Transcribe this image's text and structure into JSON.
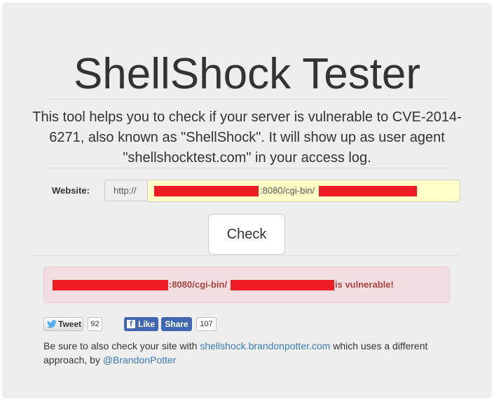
{
  "header": {
    "title": "ShellShock Tester",
    "description": "This tool helps you to check if your server is vulnerable to CVE-2014-6271, also known as \"ShellShock\". It will show up as user agent \"shellshocktest.com\" in your access log."
  },
  "form": {
    "website_label": "Website:",
    "url_prefix": "http://",
    "url_visible_part": ":8080/cgi-bin/",
    "check_button": "Check"
  },
  "result": {
    "url_visible_part": ":8080/cgi-bin/",
    "status_text": "is vulnerable!"
  },
  "social": {
    "tweet_label": "Tweet",
    "tweet_count": "92",
    "like_label": "Like",
    "share_label": "Share",
    "share_count": "107"
  },
  "footer": {
    "text_1": "Be sure to also check your site with ",
    "link_1": "shellshock.brandonpotter.com",
    "text_2": " which uses a different approach, by ",
    "link_2": "@BrandonPotter"
  },
  "colors": {
    "panel_bg": "#eeeeee",
    "input_bg": "#ffffc8",
    "alert_bg": "#f2dede",
    "alert_text": "#a94442",
    "redaction": "#ee1c24",
    "link": "#3a7ab8",
    "facebook": "#4267b2"
  },
  "icons": {
    "twitter": "twitter-bird-icon",
    "facebook": "facebook-f-icon"
  }
}
